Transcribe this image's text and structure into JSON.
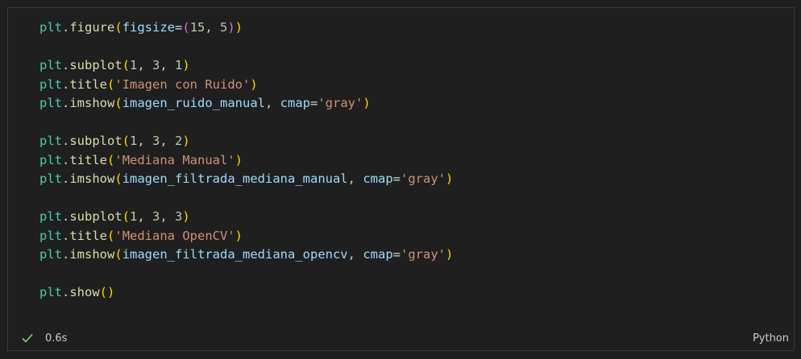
{
  "code_lines": [
    [
      [
        "mod",
        "plt"
      ],
      [
        "pun",
        "."
      ],
      [
        "fn",
        "figure"
      ],
      [
        "b1",
        "("
      ],
      [
        "var",
        "figsize"
      ],
      [
        "op",
        "="
      ],
      [
        "b2",
        "("
      ],
      [
        "num",
        "15"
      ],
      [
        "pun",
        ", "
      ],
      [
        "num",
        "5"
      ],
      [
        "b2",
        ")"
      ],
      [
        "b1",
        ")"
      ]
    ],
    [],
    [
      [
        "mod",
        "plt"
      ],
      [
        "pun",
        "."
      ],
      [
        "fn",
        "subplot"
      ],
      [
        "b1",
        "("
      ],
      [
        "num",
        "1"
      ],
      [
        "pun",
        ", "
      ],
      [
        "num",
        "3"
      ],
      [
        "pun",
        ", "
      ],
      [
        "num",
        "1"
      ],
      [
        "b1",
        ")"
      ]
    ],
    [
      [
        "mod",
        "plt"
      ],
      [
        "pun",
        "."
      ],
      [
        "fn",
        "title"
      ],
      [
        "b1",
        "("
      ],
      [
        "str",
        "'Imagen con Ruido'"
      ],
      [
        "b1",
        ")"
      ]
    ],
    [
      [
        "mod",
        "plt"
      ],
      [
        "pun",
        "."
      ],
      [
        "fn",
        "imshow"
      ],
      [
        "b1",
        "("
      ],
      [
        "var",
        "imagen_ruido_manual"
      ],
      [
        "pun",
        ", "
      ],
      [
        "var",
        "cmap"
      ],
      [
        "op",
        "="
      ],
      [
        "str",
        "'gray'"
      ],
      [
        "b1",
        ")"
      ]
    ],
    [],
    [
      [
        "mod",
        "plt"
      ],
      [
        "pun",
        "."
      ],
      [
        "fn",
        "subplot"
      ],
      [
        "b1",
        "("
      ],
      [
        "num",
        "1"
      ],
      [
        "pun",
        ", "
      ],
      [
        "num",
        "3"
      ],
      [
        "pun",
        ", "
      ],
      [
        "num",
        "2"
      ],
      [
        "b1",
        ")"
      ]
    ],
    [
      [
        "mod",
        "plt"
      ],
      [
        "pun",
        "."
      ],
      [
        "fn",
        "title"
      ],
      [
        "b1",
        "("
      ],
      [
        "str",
        "'Mediana Manual'"
      ],
      [
        "b1",
        ")"
      ]
    ],
    [
      [
        "mod",
        "plt"
      ],
      [
        "pun",
        "."
      ],
      [
        "fn",
        "imshow"
      ],
      [
        "b1",
        "("
      ],
      [
        "var",
        "imagen_filtrada_mediana_manual"
      ],
      [
        "pun",
        ", "
      ],
      [
        "var",
        "cmap"
      ],
      [
        "op",
        "="
      ],
      [
        "str",
        "'gray'"
      ],
      [
        "b1",
        ")"
      ]
    ],
    [],
    [
      [
        "mod",
        "plt"
      ],
      [
        "pun",
        "."
      ],
      [
        "fn",
        "subplot"
      ],
      [
        "b1",
        "("
      ],
      [
        "num",
        "1"
      ],
      [
        "pun",
        ", "
      ],
      [
        "num",
        "3"
      ],
      [
        "pun",
        ", "
      ],
      [
        "num",
        "3"
      ],
      [
        "b1",
        ")"
      ]
    ],
    [
      [
        "mod",
        "plt"
      ],
      [
        "pun",
        "."
      ],
      [
        "fn",
        "title"
      ],
      [
        "b1",
        "("
      ],
      [
        "str",
        "'Mediana OpenCV'"
      ],
      [
        "b1",
        ")"
      ]
    ],
    [
      [
        "mod",
        "plt"
      ],
      [
        "pun",
        "."
      ],
      [
        "fn",
        "imshow"
      ],
      [
        "b1",
        "("
      ],
      [
        "var",
        "imagen_filtrada_mediana_opencv"
      ],
      [
        "pun",
        ", "
      ],
      [
        "var",
        "cmap"
      ],
      [
        "op",
        "="
      ],
      [
        "str",
        "'gray'"
      ],
      [
        "b1",
        ")"
      ]
    ],
    [],
    [
      [
        "mod",
        "plt"
      ],
      [
        "pun",
        "."
      ],
      [
        "fn",
        "show"
      ],
      [
        "b1",
        "()"
      ]
    ]
  ],
  "status": {
    "icon": "checkmark-icon",
    "icon_color": "#89d185",
    "execution_time": "0.6s",
    "language": "Python"
  }
}
